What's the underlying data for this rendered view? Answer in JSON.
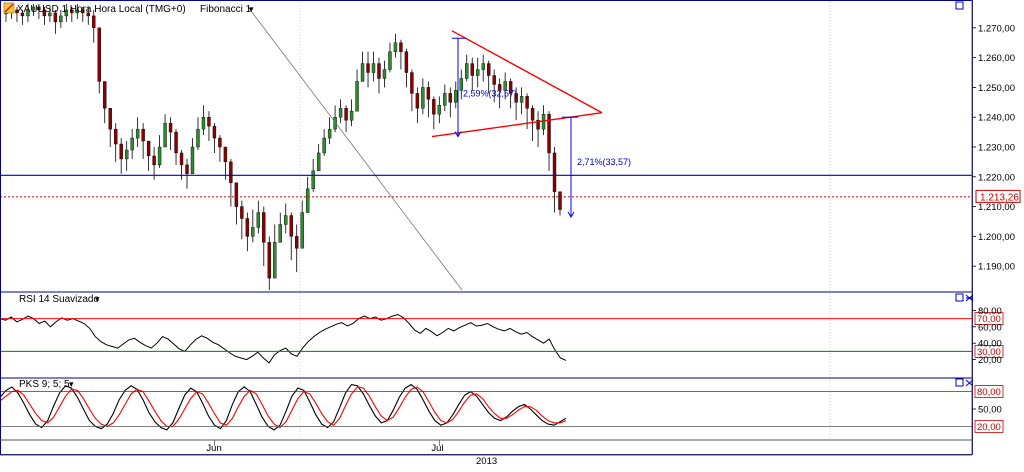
{
  "header": {
    "symbol_label": "XAUUSD 1 Hora Hora Local (TMG+0)",
    "fib_label": "Fibonacci 1",
    "dropdown_glyph": "▾"
  },
  "colors": {
    "background": "#ffffff",
    "axis_border": "#00008b",
    "candle_up": "#2e8b2e",
    "candle_down": "#8b0000",
    "wick": "#000000",
    "trendline": "#ff0000",
    "hline_blue": "#0000cc",
    "price_line": "#cc0000",
    "rsi_line": "#000000",
    "rsi_upper": "#ff0000",
    "rsi_lower": "#008000",
    "pks_k": "#000000",
    "pks_d": "#ff0000",
    "measure_arrow": "#0000ff"
  },
  "chart_data": [
    {
      "type": "candlestick",
      "panel": "price",
      "ylim": [
        1182,
        1278
      ],
      "y_ticks": [
        "1.270,00",
        "1.260,00",
        "1.250,00",
        "1.240,00",
        "1.230,00",
        "1.220,00",
        "1.210,00",
        "1.200,00",
        "1.190,00"
      ],
      "y_tick_values": [
        1270,
        1260,
        1250,
        1240,
        1230,
        1220,
        1210,
        1200,
        1190
      ],
      "x_labels": [
        "Jun",
        "Jul"
      ],
      "x_label_index": [
        38,
        79
      ],
      "year_label": "2013",
      "current_price": 1213.26,
      "current_price_label": "1.213,26",
      "horizontal_level": 1220.5,
      "annotations": [
        {
          "text": "2,59%(32,57)"
        },
        {
          "text": "2,71%(33,57)"
        }
      ],
      "close": [
        1275,
        1276,
        1275,
        1274,
        1276,
        1277,
        1276,
        1274,
        1275,
        1272,
        1274,
        1276,
        1275,
        1276,
        1275,
        1274,
        1270,
        1252,
        1243,
        1236,
        1231,
        1226,
        1229,
        1233,
        1236,
        1232,
        1227,
        1224,
        1230,
        1238,
        1235,
        1228,
        1224,
        1221,
        1230,
        1236,
        1240,
        1237,
        1233,
        1230,
        1225,
        1218,
        1210,
        1206,
        1200,
        1203,
        1208,
        1198,
        1186,
        1198,
        1204,
        1207,
        1200,
        1196,
        1208,
        1216,
        1222,
        1228,
        1233,
        1236,
        1240,
        1243,
        1239,
        1242,
        1252,
        1258,
        1255,
        1258,
        1253,
        1256,
        1262,
        1265,
        1262,
        1255,
        1248,
        1243,
        1250,
        1246,
        1241,
        1244,
        1248,
        1245,
        1249,
        1253,
        1258,
        1254,
        1256,
        1258,
        1254,
        1251,
        1249,
        1252,
        1248,
        1245,
        1247,
        1243,
        1239,
        1236,
        1241,
        1228,
        1215,
        1209
      ],
      "high": [
        1277,
        1278,
        1277,
        1276,
        1278,
        1278,
        1278,
        1277,
        1277,
        1276,
        1276,
        1278,
        1277,
        1278,
        1277,
        1277,
        1276,
        1270,
        1250,
        1240,
        1238,
        1233,
        1232,
        1236,
        1240,
        1238,
        1232,
        1230,
        1234,
        1241,
        1240,
        1236,
        1229,
        1226,
        1233,
        1240,
        1244,
        1242,
        1238,
        1234,
        1230,
        1226,
        1218,
        1212,
        1208,
        1209,
        1212,
        1210,
        1200,
        1204,
        1208,
        1211,
        1208,
        1204,
        1212,
        1220,
        1226,
        1231,
        1236,
        1240,
        1244,
        1246,
        1244,
        1246,
        1256,
        1262,
        1262,
        1262,
        1260,
        1259,
        1265,
        1268,
        1266,
        1263,
        1256,
        1250,
        1253,
        1252,
        1247,
        1247,
        1251,
        1250,
        1252,
        1256,
        1261,
        1260,
        1260,
        1261,
        1259,
        1256,
        1253,
        1255,
        1253,
        1250,
        1250,
        1248,
        1244,
        1242,
        1244,
        1242,
        1230,
        1215
      ],
      "low": [
        1272,
        1273,
        1272,
        1271,
        1272,
        1274,
        1273,
        1271,
        1272,
        1268,
        1270,
        1272,
        1272,
        1273,
        1272,
        1271,
        1265,
        1248,
        1238,
        1230,
        1225,
        1221,
        1222,
        1226,
        1230,
        1226,
        1222,
        1219,
        1223,
        1230,
        1229,
        1224,
        1219,
        1216,
        1222,
        1229,
        1234,
        1232,
        1228,
        1225,
        1219,
        1210,
        1204,
        1199,
        1195,
        1198,
        1201,
        1190,
        1182,
        1189,
        1198,
        1201,
        1192,
        1188,
        1198,
        1208,
        1215,
        1222,
        1227,
        1231,
        1235,
        1238,
        1235,
        1237,
        1244,
        1252,
        1250,
        1252,
        1248,
        1250,
        1255,
        1260,
        1256,
        1250,
        1242,
        1238,
        1241,
        1240,
        1236,
        1238,
        1242,
        1240,
        1243,
        1246,
        1252,
        1249,
        1250,
        1252,
        1248,
        1245,
        1243,
        1246,
        1243,
        1239,
        1241,
        1236,
        1232,
        1230,
        1234,
        1222,
        1208,
        1207
      ]
    },
    {
      "type": "line",
      "panel": "indicator",
      "title": "RSI 14 Suavizado",
      "ylim": [
        0,
        100
      ],
      "y_ticks": [
        "80,00",
        "60,00",
        "40,00",
        "20,00"
      ],
      "y_tick_values": [
        80,
        60,
        40,
        20
      ],
      "levels": [
        {
          "value": 70,
          "label": "70,00"
        },
        {
          "value": 30,
          "label": "30,00"
        }
      ],
      "values": [
        70,
        68,
        72,
        66,
        69,
        73,
        70,
        64,
        67,
        60,
        66,
        71,
        68,
        70,
        67,
        64,
        58,
        48,
        42,
        38,
        36,
        34,
        39,
        44,
        46,
        41,
        37,
        34,
        40,
        48,
        45,
        39,
        33,
        30,
        38,
        45,
        49,
        46,
        41,
        38,
        33,
        28,
        24,
        22,
        20,
        24,
        29,
        22,
        16,
        26,
        31,
        34,
        27,
        24,
        34,
        42,
        48,
        53,
        57,
        60,
        63,
        65,
        61,
        64,
        70,
        73,
        70,
        72,
        68,
        70,
        73,
        75,
        71,
        64,
        56,
        52,
        58,
        54,
        49,
        53,
        58,
        55,
        59,
        62,
        65,
        61,
        62,
        64,
        60,
        57,
        55,
        58,
        54,
        51,
        53,
        48,
        44,
        40,
        45,
        32,
        22,
        19
      ]
    },
    {
      "type": "line",
      "panel": "indicator",
      "title": "PKS 9; 5; 5",
      "ylim": [
        0,
        100
      ],
      "y_ticks": [
        "50,00"
      ],
      "y_tick_values": [
        50
      ],
      "levels": [
        {
          "value": 80,
          "label": "80,00"
        },
        {
          "value": 20,
          "label": "20,00"
        }
      ],
      "series": [
        {
          "name": "",
          "values": [
            70,
            82,
            88,
            78,
            60,
            40,
            24,
            18,
            30,
            55,
            78,
            90,
            86,
            70,
            50,
            30,
            20,
            16,
            24,
            42,
            66,
            82,
            90,
            84,
            66,
            44,
            28,
            18,
            14,
            26,
            50,
            74,
            86,
            80,
            60,
            38,
            22,
            16,
            30,
            58,
            80,
            88,
            80,
            58,
            36,
            20,
            14,
            22,
            46,
            72,
            86,
            82,
            62,
            40,
            24,
            18,
            28,
            52,
            78,
            92,
            90,
            76,
            56,
            38,
            26,
            30,
            48,
            70,
            86,
            92,
            84,
            66,
            46,
            30,
            22,
            26,
            40,
            58,
            74,
            80,
            72,
            58,
            44,
            34,
            30,
            36,
            46,
            54,
            58,
            50,
            40,
            30,
            24,
            22,
            28,
            34
          ]
        },
        {
          "name": "",
          "values": [
            64,
            72,
            80,
            82,
            74,
            58,
            42,
            30,
            26,
            36,
            54,
            72,
            84,
            82,
            68,
            50,
            34,
            24,
            20,
            26,
            40,
            58,
            76,
            84,
            80,
            64,
            46,
            30,
            20,
            20,
            32,
            50,
            68,
            80,
            76,
            60,
            42,
            26,
            22,
            34,
            54,
            72,
            82,
            76,
            58,
            38,
            24,
            18,
            28,
            48,
            68,
            80,
            76,
            60,
            42,
            28,
            22,
            34,
            56,
            76,
            88,
            86,
            72,
            54,
            38,
            30,
            36,
            52,
            70,
            84,
            88,
            80,
            62,
            44,
            30,
            26,
            32,
            46,
            62,
            74,
            76,
            68,
            54,
            42,
            34,
            34,
            40,
            48,
            54,
            54,
            48,
            38,
            30,
            26,
            26,
            30
          ]
        }
      ]
    }
  ]
}
